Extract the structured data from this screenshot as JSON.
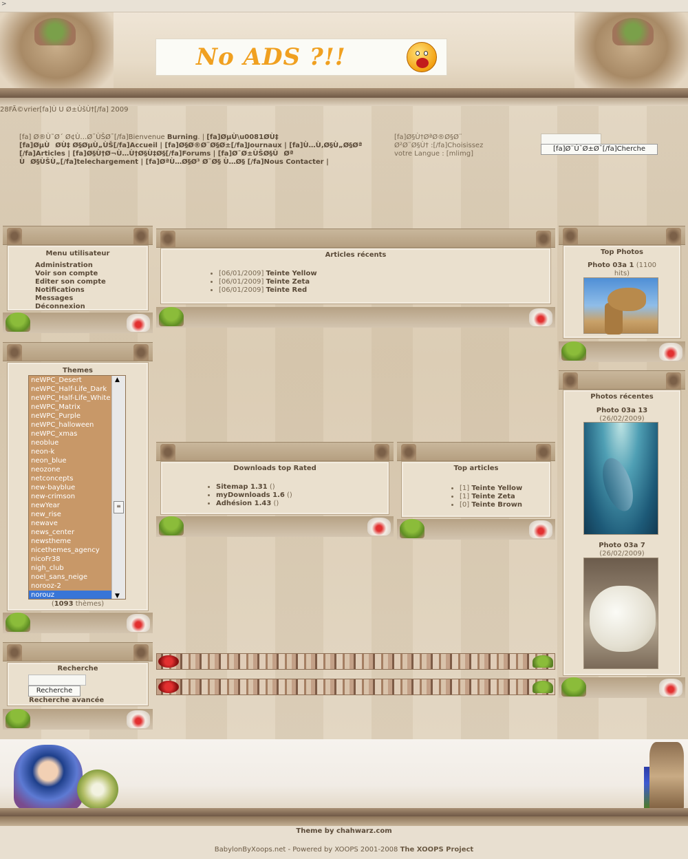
{
  "topstrip": ">",
  "header": {
    "banner_text": "No ADS ?!!"
  },
  "date_line": "28FÃ©vrier[fa]Ù U Ø±ÙšÙ†[/fa] 2009",
  "nav": {
    "welcome_prefix": "[fa] Ø®Ù˜Ø´ Ø¢Ù…Ø¯ÙŠØ¯[/fa]Bienvenue ",
    "user": "Burning",
    "links_line1": "[fa]ØµÙØ­Ù‡ Ø§ØµÙ„ÙŠ[/fa]Accueil | [fa]Ø§Ø®Ø¨Ø§Ø±[/fa]Journaux | [fa]Ù…Ù‚Ø§Ù„Ø§Øª",
    "links_line2": "[/fa]Articles | [fa]Ø§Ù†Ø¬Ù…Ù†Ø§Ù‡Ø§[/fa]Forums | [fa]Ø¯Ø±ÙŠØ§ÙØª",
    "links_line3": "ÙØ§ÙŠÙ„[/fa]telechargement | [fa]ØªÙ…Ø§Ø³ Ø¨Ø§ Ù…Ø§ [/fa]Nous Contacter |"
  },
  "lang": {
    "line1": "[fa]Ø§Ù†ØªØ®Ø§Ø¨",
    "line2": "Ø²Ø¨Ø§Ù† :[/fa]Choisissez",
    "line3": "votre Langue : [mlimg]"
  },
  "top_search": {
    "button": "[fa]Ø¨Ú¯Ø±Ø¯[/fa]Cherche"
  },
  "menu": {
    "title": "Menu utilisateur",
    "items": [
      "Administration",
      "Voir son compte",
      "Editer son compte",
      "Notifications",
      "Messages",
      "Déconnexion"
    ]
  },
  "themes": {
    "title": "Themes",
    "items": [
      "neWPC_Desert",
      "neWPC_Half-Life_Dark",
      "neWPC_Half-Life_White",
      "neWPC_Matrix",
      "neWPC_Purple",
      "neWPC_halloween",
      "neWPC_xmas",
      "neoblue",
      "neon-k",
      "neon_blue",
      "neozone",
      "netconcepts",
      "new-bayblue",
      "new-crimson",
      "newYear",
      "new_rise",
      "newave",
      "news_center",
      "newstheme",
      "nicethemes_agency",
      "nicoFr38",
      "nigh_club",
      "noel_sans_neige",
      "norooz-2",
      "norouz"
    ],
    "selected": "norouz",
    "count_prefix": "(",
    "count": "1093",
    "count_suffix": " thèmes)"
  },
  "search": {
    "title": "Recherche",
    "button": "Recherche",
    "advanced": "Recherche avancée"
  },
  "recent_articles": {
    "title": "Articles récents",
    "items": [
      {
        "date": "[06/01/2009]",
        "name": "Teinte Yellow"
      },
      {
        "date": "[06/01/2009]",
        "name": "Teinte Zeta"
      },
      {
        "date": "[06/01/2009]",
        "name": "Teinte Red"
      }
    ]
  },
  "downloads": {
    "title": "Downloads top Rated",
    "items": [
      {
        "name": "Sitemap 1.31",
        "count": "()"
      },
      {
        "name": "myDownloads 1.6",
        "count": "()"
      },
      {
        "name": "Adhésion 1.43",
        "count": "()"
      }
    ]
  },
  "top_articles": {
    "title": "Top articles",
    "items": [
      {
        "rank": "[1]",
        "name": "Teinte Yellow"
      },
      {
        "rank": "[1]",
        "name": "Teinte Zeta"
      },
      {
        "rank": "[0]",
        "name": "Teinte Brown"
      }
    ]
  },
  "top_photos": {
    "title": "Top Photos",
    "photo_name": "Photo 03a 1",
    "photo_hits": "(1100",
    "photo_hits2": "hits)"
  },
  "recent_photos": {
    "title": "Photos récentes",
    "photos": [
      {
        "name": "Photo 03a 13",
        "date": "(26/02/2009)"
      },
      {
        "name": "Photo 03a 7",
        "date": "(26/02/2009)"
      }
    ]
  },
  "footer": {
    "theme_credit": "Theme by chahwarz.com",
    "powered_prefix": "BabylonByXoops.net - Powered by XOOPS 2001-2008 ",
    "powered_link": "The XOOPS Project"
  }
}
